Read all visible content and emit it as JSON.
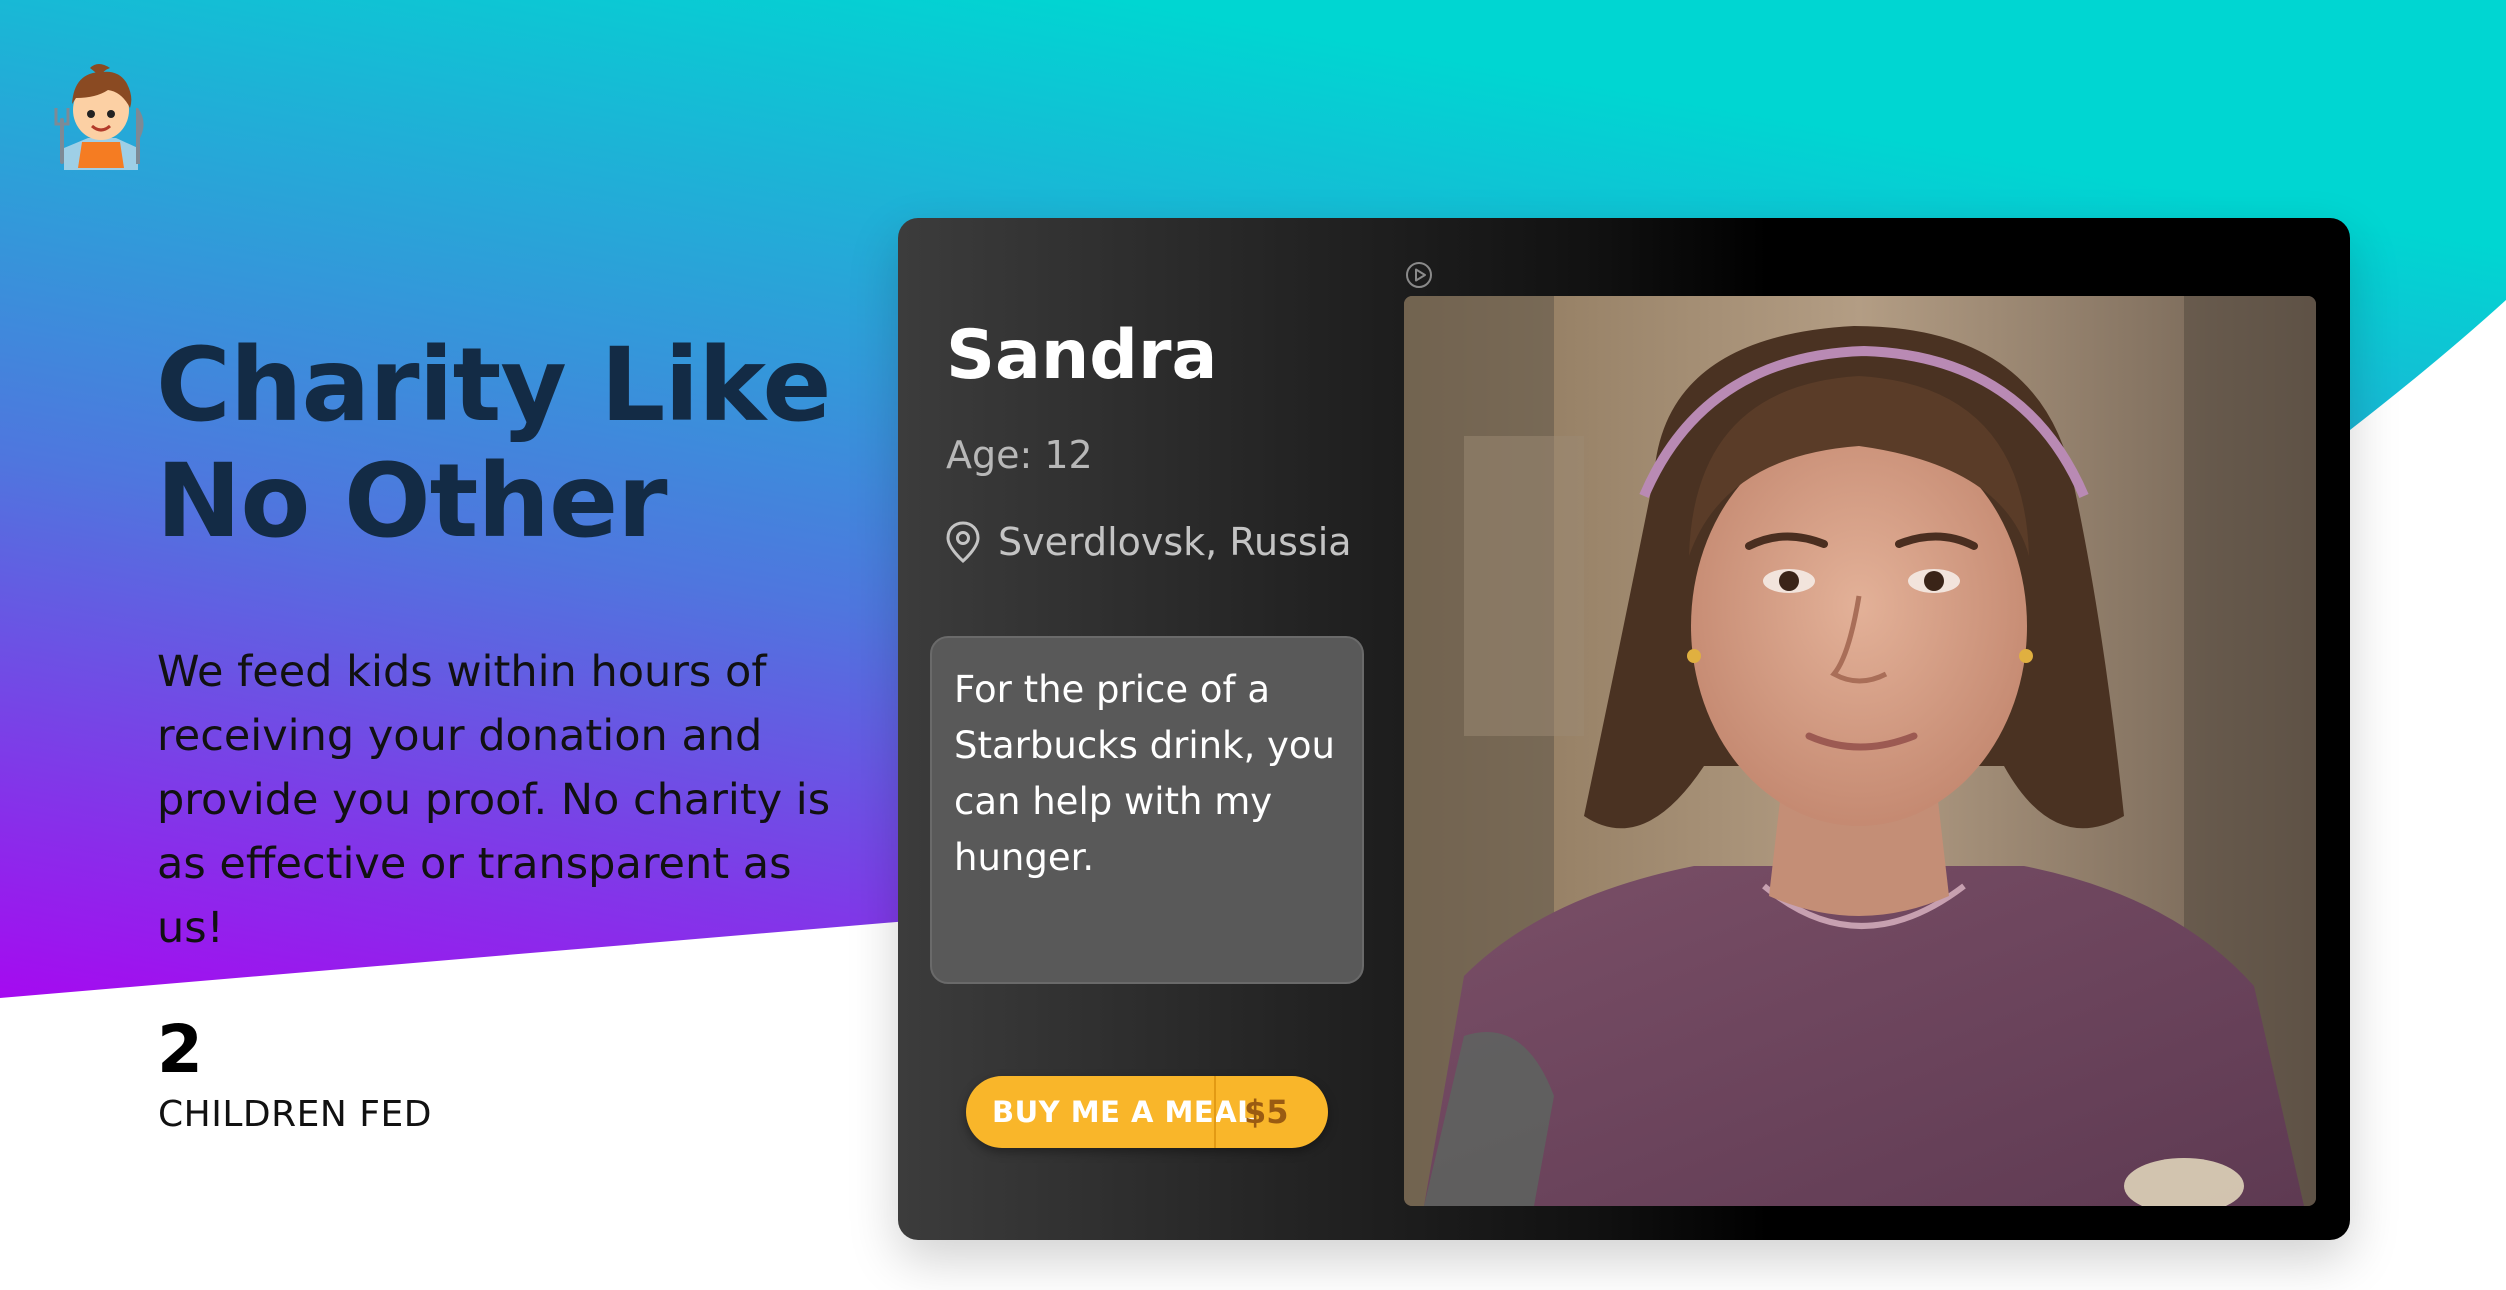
{
  "hero": {
    "title": "Charity Like No Other",
    "description": "We feed kids within hours of receiving your donation and provide you proof. No charity is as effective or transparent as us!"
  },
  "stats": {
    "count": "2",
    "label": "CHILDREN FED"
  },
  "profile": {
    "name": "Sandra",
    "age": "Age: 12",
    "location": "Sverdlovsk, Russia",
    "quote": "For the price of a Starbucks drink, you can help with my hunger.",
    "button": {
      "label": "BUY ME A MEAL",
      "price": "$5"
    }
  },
  "icons": {
    "logo": "boy-with-fork-and-knife-logo",
    "location": "map-pin-icon",
    "play": "play-circle-icon"
  },
  "colors": {
    "teal": "#00d6d2",
    "purple": "#a50af0",
    "title": "#132b45",
    "button": "#f9b62a",
    "price": "#9a5b12"
  }
}
